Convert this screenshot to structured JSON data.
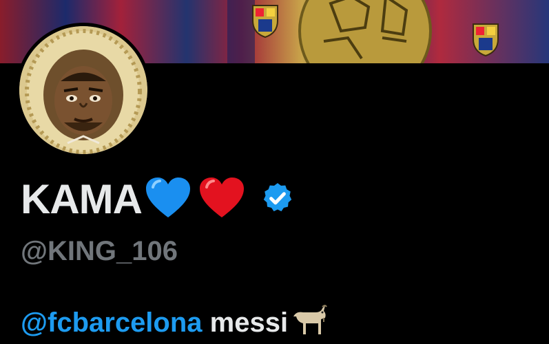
{
  "profile": {
    "display_name": "KAMA",
    "name_emojis": [
      "blue-heart",
      "red-heart"
    ],
    "verified": true,
    "handle": "@KING_106",
    "bio": {
      "mention": "@fcbarcelona",
      "text": " messi",
      "emoji": "goat"
    }
  },
  "colors": {
    "background": "#000000",
    "name": "#e7e9ea",
    "handle": "#71767b",
    "link": "#1d9bf0",
    "verified_badge": "#1d9bf0"
  }
}
